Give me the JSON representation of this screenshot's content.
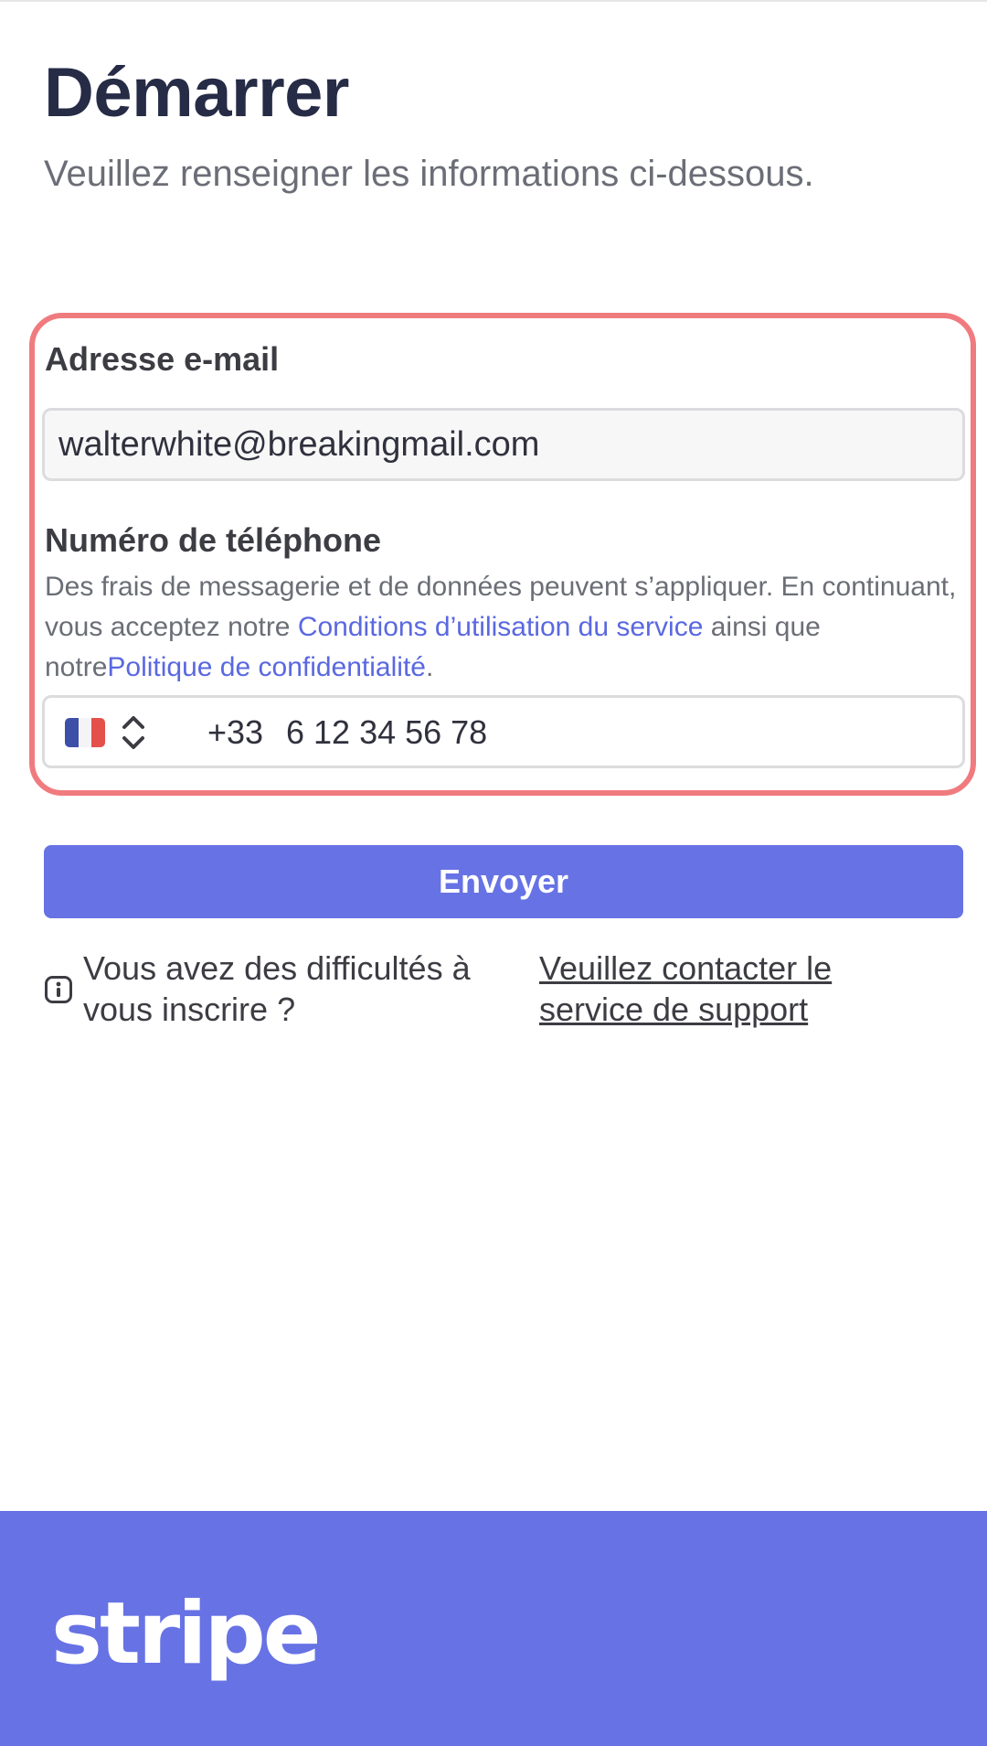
{
  "header": {
    "title": "Démarrer",
    "subtitle": "Veuillez renseigner les informations ci-dessous."
  },
  "form": {
    "email_label": "Adresse e-mail",
    "email_value": "walterwhite@breakingmail.com",
    "phone_label": "Numéro de téléphone",
    "disclaimer": {
      "text_before": "Des frais de messagerie et de données peuvent s’appliquer. En continuant, vous acceptez notre ",
      "terms_link": "Conditions d’utilisation du service",
      "text_middle": " ainsi que notre",
      "privacy_link": "Politique de confidentialité",
      "text_after": "."
    },
    "phone": {
      "country_flag": "france-flag-icon",
      "dial_code": "+33",
      "number": "6 12 34 56 78"
    },
    "submit_label": "Envoyer"
  },
  "help": {
    "question": "Vous avez des difficultés à vous inscrire ?",
    "link_label": "Veuillez contacter le service de support"
  },
  "footer": {
    "logo_text": "stripe"
  },
  "colors": {
    "accent": "#6772e5",
    "link": "#5a68e0",
    "highlight_border": "#f07b7f",
    "title": "#262b46"
  }
}
